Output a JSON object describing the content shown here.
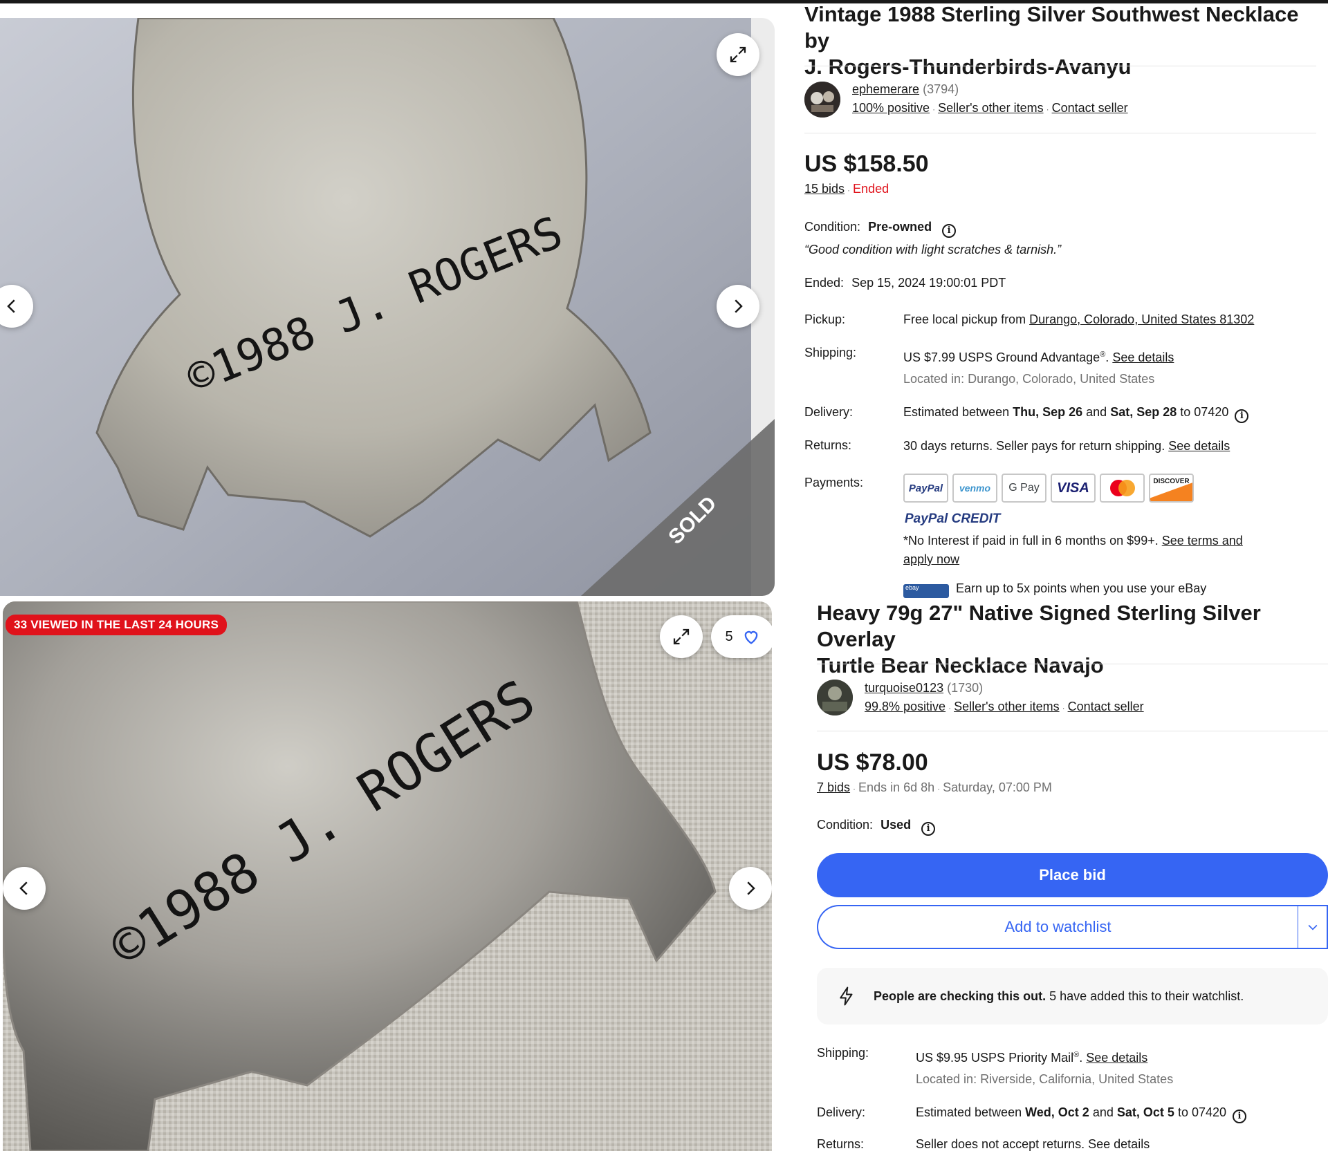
{
  "listing1": {
    "title_line1": "Vintage 1988 Sterling Silver Southwest Necklace by",
    "title_line2": "J. Rogers-Thunderbirds-Avanyu",
    "image_engraving": "©1988 J. ROGERS",
    "sold_label": "SOLD",
    "seller": {
      "name": "ephemerare",
      "count": "(3794)",
      "positive": "100% positive",
      "other_items": "Seller's other items",
      "contact": "Contact seller"
    },
    "price": "US $158.50",
    "bids": "15 bids",
    "status": "Ended",
    "condition_label": "Condition:",
    "condition_value": "Pre-owned",
    "condition_note": "“Good condition with light scratches & tarnish.”",
    "ended_label": "Ended:",
    "ended_value": "Sep 15, 2024 19:00:01 PDT",
    "pickup_label": "Pickup:",
    "pickup_prefix": "Free local pickup from",
    "pickup_location": "Durango, Colorado, United States 81302",
    "shipping_label": "Shipping:",
    "shipping_price": "US $7.99 USPS Ground Advantage",
    "shipping_reg": "®",
    "shipping_period": ".",
    "shipping_link": "See details",
    "shipping_located": "Located in: Durango, Colorado, United States",
    "delivery_label": "Delivery:",
    "delivery_pre": "Estimated between",
    "delivery_d1": "Thu, Sep 26",
    "delivery_and": "and",
    "delivery_d2": "Sat, Sep 28",
    "delivery_to": "to 07420",
    "returns_label": "Returns:",
    "returns_text": "30 days returns. Seller pays for return shipping.",
    "returns_link": "See details",
    "payments_label": "Payments:",
    "payment_methods": [
      "PayPal",
      "venmo",
      "G Pay",
      "VISA",
      "Mastercard",
      "DISCOVER"
    ],
    "paypal_credit": "PayPal CREDIT",
    "credit_text": "*No Interest if paid in full in 6 months on $99+.",
    "credit_link1": "See terms and",
    "credit_link2": "apply now",
    "ebay_points": "Earn up to 5x points when you use your eBay",
    "ebay_mini": "ebay"
  },
  "listing2": {
    "badge": "33 VIEWED IN THE LAST 24 HOURS",
    "watch_count": "5",
    "image_engraving": "©1988 J. ROGERS",
    "title_line1": "Heavy 79g 27\" Native Signed Sterling Silver Overlay",
    "title_line2": "Turtle Bear Necklace Navajo",
    "seller": {
      "name": "turquoise0123",
      "count": "(1730)",
      "positive": "99.8% positive",
      "other_items": "Seller's other items",
      "contact": "Contact seller"
    },
    "price": "US $78.00",
    "bids": "7 bids",
    "ends": "Ends in 6d 8h",
    "ends_time": "Saturday, 07:00 PM",
    "condition_label": "Condition:",
    "condition_value": "Used",
    "place_bid": "Place bid",
    "add_watchlist": "Add to watchlist",
    "notice_bold": "People are checking this out.",
    "notice_text": "5 have added this to their watchlist.",
    "shipping_label": "Shipping:",
    "shipping_price": "US $9.95 USPS Priority Mail",
    "shipping_reg": "®",
    "shipping_period": ".",
    "shipping_link": "See details",
    "shipping_located": "Located in: Riverside, California, United States",
    "delivery_label": "Delivery:",
    "delivery_pre": "Estimated between",
    "delivery_d1": "Wed, Oct 2",
    "delivery_and": "and",
    "delivery_d2": "Sat, Oct 5",
    "delivery_to": "to 07420",
    "returns_label": "Returns:",
    "returns_text": "Seller does not accept returns. See details"
  },
  "colors": {
    "accent": "#3665f3",
    "red": "#e0121b",
    "text": "#191919",
    "muted": "#707070"
  }
}
